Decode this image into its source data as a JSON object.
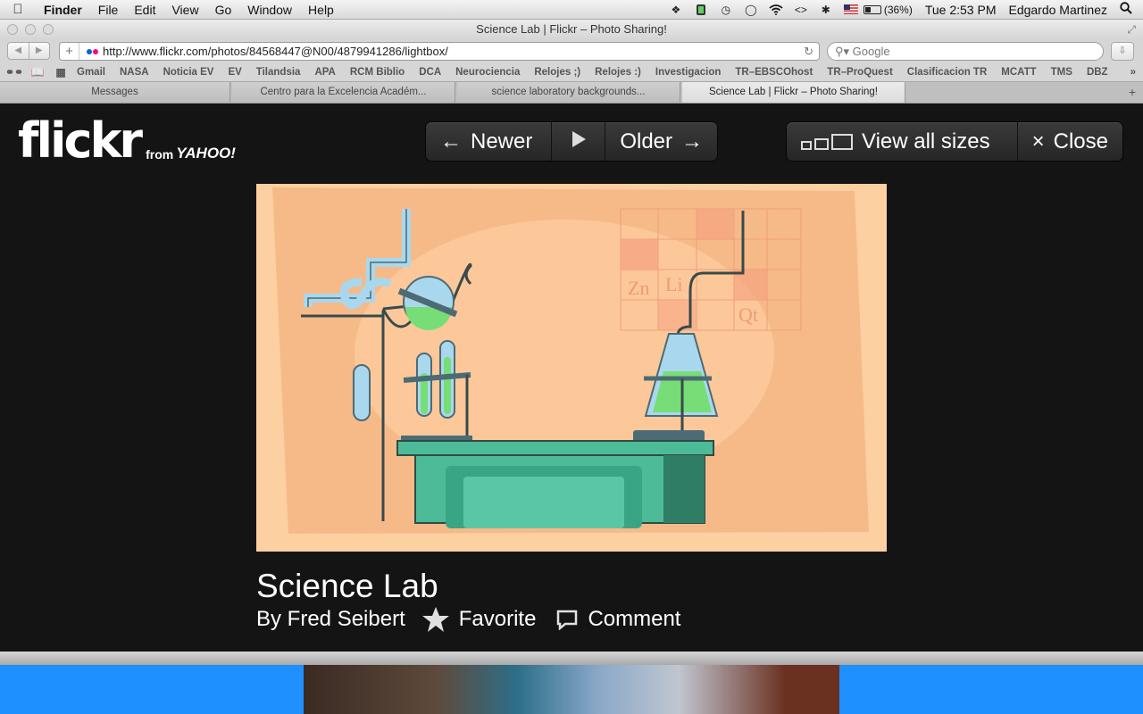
{
  "menubar": {
    "app": "Finder",
    "items": [
      "File",
      "Edit",
      "View",
      "Go",
      "Window",
      "Help"
    ],
    "battery": "(36%)",
    "battery_level": 0.36,
    "clock": "Tue 2:53 PM",
    "user": "Edgardo Martinez",
    "status_icons": [
      "dropbox-icon",
      "evernote-icon",
      "timemachine-icon",
      "sync-icon",
      "wifi-icon",
      "code-icon",
      "bluetooth-icon",
      "flag-us-icon"
    ]
  },
  "window": {
    "title": "Science Lab | Flickr – Photo Sharing!",
    "url": "http://www.flickr.com/photos/84568447@N00/4879941286/lightbox/",
    "search_placeholder": "Google"
  },
  "bookmarks": [
    "Gmail",
    "NASA",
    "Noticia EV",
    "EV",
    "Tilandsia",
    "APA",
    "RCM Biblio",
    "DCA",
    "Neurociencia",
    "Relojes ;)",
    "Relojes :)",
    "Investigacion",
    "TR–EBSCOhost",
    "TR–ProQuest",
    "Clasificacion TR",
    "MCATT",
    "TMS",
    "DBZ"
  ],
  "tabs": [
    {
      "label": "Messages",
      "active": false
    },
    {
      "label": "Centro para la Excelencia Académ...",
      "active": false
    },
    {
      "label": "science laboratory backgrounds...",
      "active": false
    },
    {
      "label": "Science Lab | Flickr – Photo Sharing!",
      "active": true
    }
  ],
  "flickr": {
    "logo": "flickr",
    "logo_from": "from",
    "logo_yahoo": "YAHOO!",
    "nav": {
      "newer": "Newer",
      "older": "Older"
    },
    "sizes": {
      "view_all": "View all sizes",
      "close": "Close"
    },
    "photo": {
      "title": "Science Lab",
      "byline": "By Fred Seibert",
      "favorite": "Favorite",
      "comment": "Comment",
      "chart_labels": [
        "Zn",
        "Li",
        "Qt"
      ]
    }
  },
  "colors": {
    "lightbox_bg": "#141414",
    "desktop": "#1e90ff",
    "photo_bg": "#fcd0a1",
    "lab_table": "#4dbb98"
  }
}
